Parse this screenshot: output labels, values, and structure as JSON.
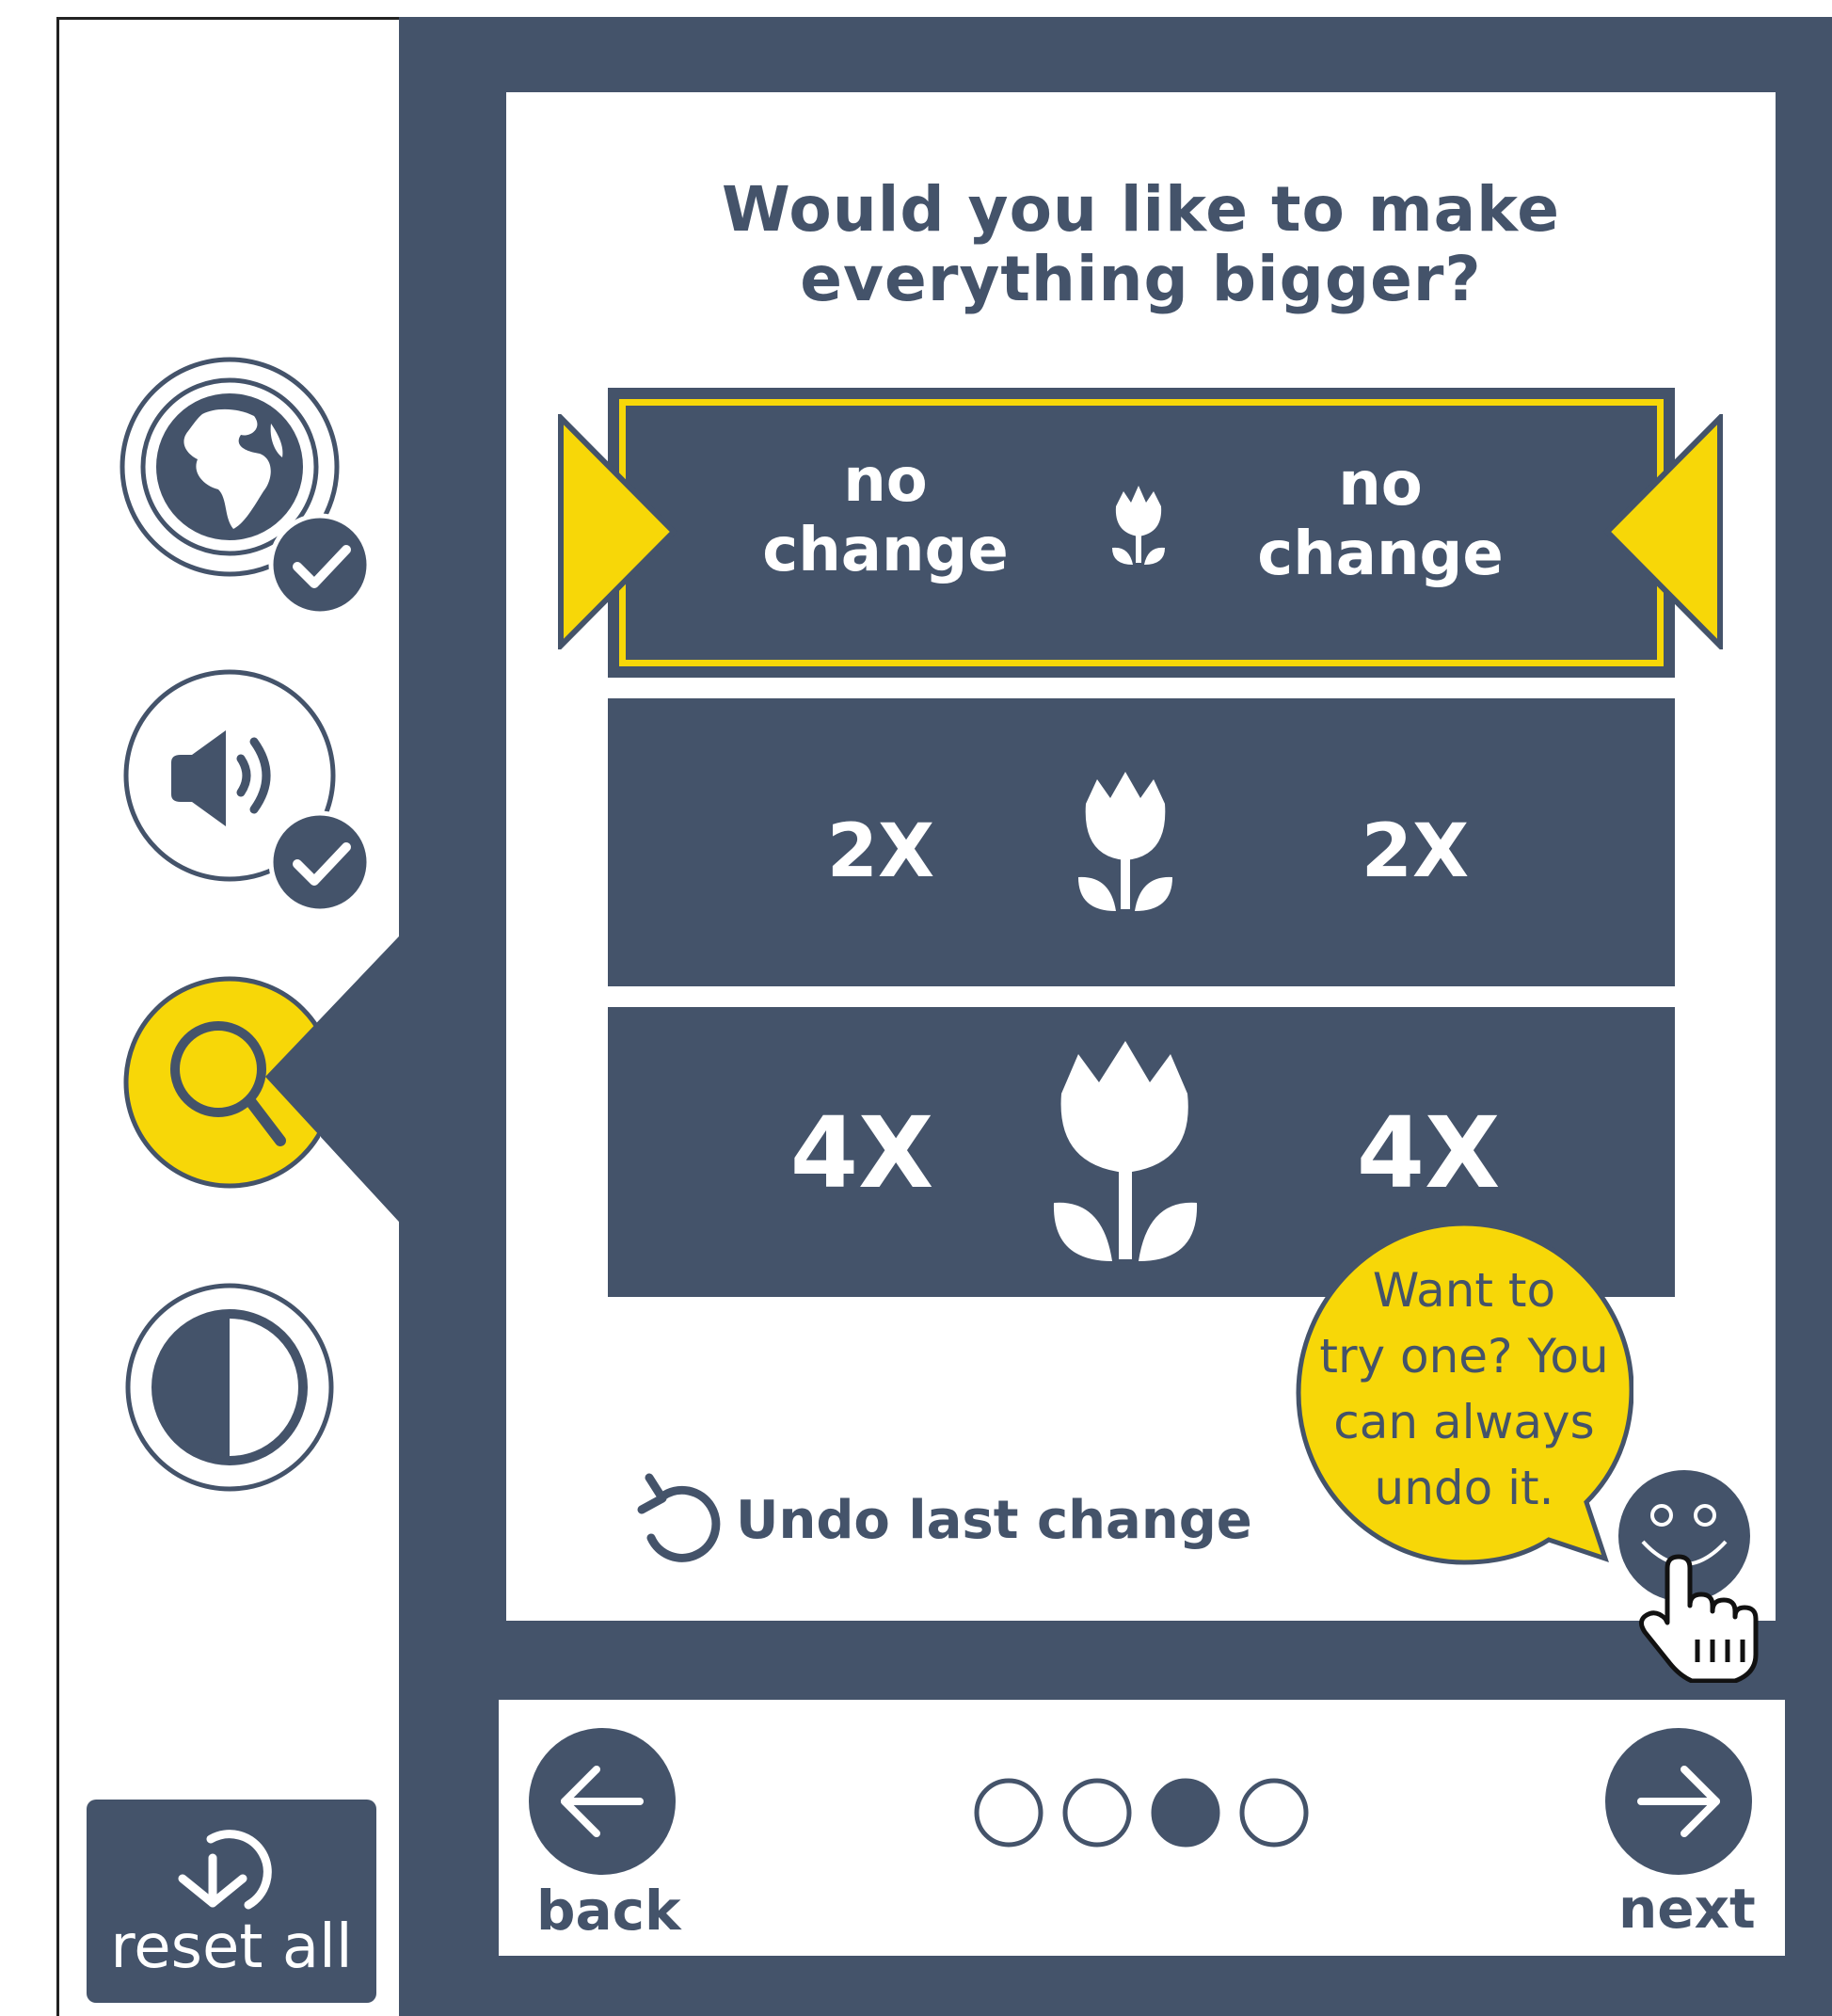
{
  "question": {
    "line1": "Would you like to make",
    "line2": "everything bigger?"
  },
  "options": [
    {
      "left_line1": "no",
      "left_line2": "change",
      "right_line1": "no",
      "right_line2": "change",
      "selected": true,
      "icon": "tulip-icon-small"
    },
    {
      "left": "2X",
      "right": "2X",
      "selected": false,
      "icon": "tulip-icon-medium"
    },
    {
      "left": "4X",
      "right": "4X",
      "selected": false,
      "icon": "tulip-icon-large"
    }
  ],
  "undo": {
    "label": "Undo last change",
    "icon": "undo-icon"
  },
  "helper": {
    "lines": [
      "Want to",
      "try one? You",
      "can always",
      "undo it."
    ],
    "icon": "smiley-helper-icon"
  },
  "sidebar": {
    "items": [
      {
        "icon": "globe-icon",
        "completed": true
      },
      {
        "icon": "speaker-icon",
        "completed": true
      },
      {
        "icon": "magnifier-icon",
        "active": true
      },
      {
        "icon": "contrast-icon",
        "completed": false
      }
    ],
    "reset_label": "reset all"
  },
  "nav": {
    "back_label": "back",
    "next_label": "next",
    "steps_total": 4,
    "step_current": 3
  },
  "colors": {
    "primary": "#44536a",
    "accent": "#f7d708",
    "background": "#ffffff"
  }
}
